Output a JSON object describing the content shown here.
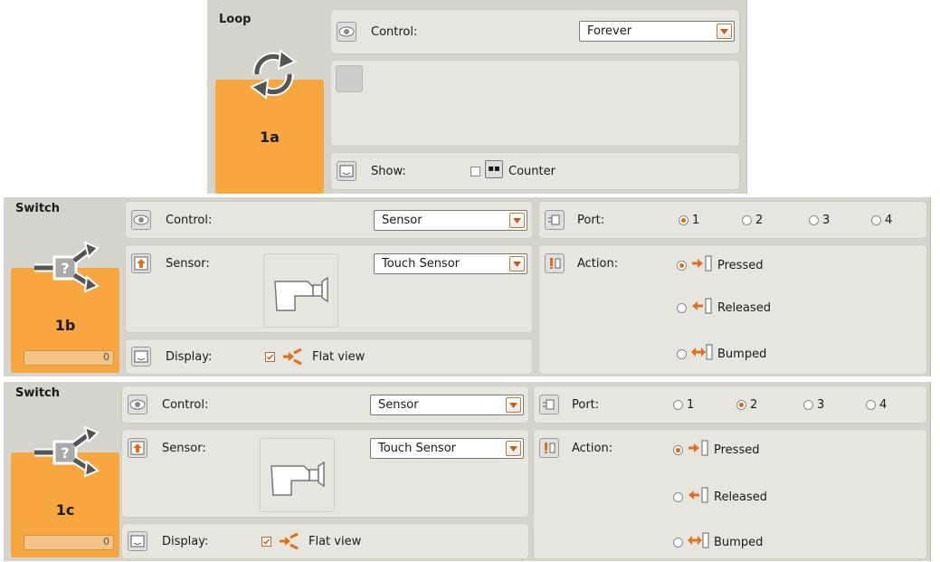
{
  "loop": {
    "title": "Loop",
    "block_id": "1a",
    "control_label": "Control:",
    "control_value": "Forever",
    "show_label": "Show:",
    "counter_label": "Counter",
    "counter_checked": false
  },
  "switch_b": {
    "title": "Switch",
    "block_id": "1b",
    "counter_value": "0",
    "control_label": "Control:",
    "control_value": "Sensor",
    "sensor_label": "Sensor:",
    "sensor_value": "Touch Sensor",
    "display_label": "Display:",
    "flat_view_label": "Flat view",
    "flat_view_checked": true,
    "port_label": "Port:",
    "ports": [
      "1",
      "2",
      "3",
      "4"
    ],
    "selected_port": "1",
    "action_label": "Action:",
    "actions": [
      "Pressed",
      "Released",
      "Bumped"
    ],
    "selected_action": "Pressed"
  },
  "switch_c": {
    "title": "Switch",
    "block_id": "1c",
    "counter_value": "0",
    "control_label": "Control:",
    "control_value": "Sensor",
    "sensor_label": "Sensor:",
    "sensor_value": "Touch Sensor",
    "display_label": "Display:",
    "flat_view_label": "Flat view",
    "flat_view_checked": true,
    "port_label": "Port:",
    "ports": [
      "1",
      "2",
      "3",
      "4"
    ],
    "selected_port": "2",
    "action_label": "Action:",
    "actions": [
      "Pressed",
      "Released",
      "Bumped"
    ],
    "selected_action": "Pressed"
  },
  "icons": {
    "eye": "eye-icon",
    "loop": "loop-arrows-icon",
    "switch": "switch-branch-icon",
    "show": "show-monitor-icon",
    "counter": "counter-icon",
    "sensor": "sensor-upload-icon",
    "port": "port-plug-icon",
    "action": "action-alert-icon",
    "flat_view": "flat-view-icon",
    "dropdown": "chevron-down-icon"
  },
  "colors": {
    "accent_orange": "#f7a640",
    "panel_bg": "#e6e6de",
    "frame_bg": "#d4d4cc",
    "radio_selected": "#e06a10"
  }
}
